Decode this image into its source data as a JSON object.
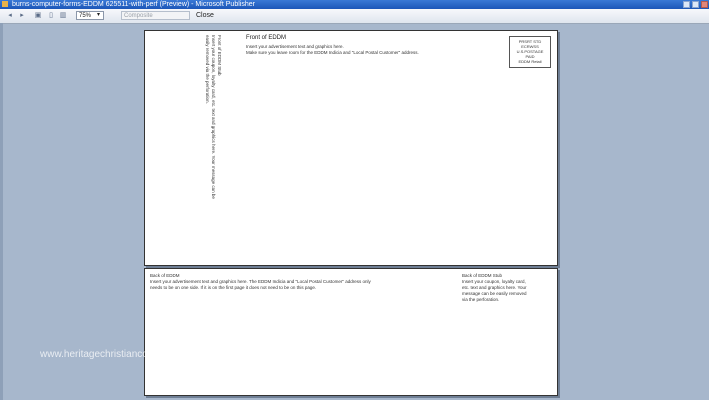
{
  "window": {
    "title": "burns-computer-forms-EDDM 625511-with-perf (Preview) - Microsoft Publisher"
  },
  "toolbar": {
    "zoom_value": "75%",
    "page_select": "Composite",
    "close_label": "Close"
  },
  "front": {
    "vertical_lines": [
      "Front of EDDM Stub",
      "Insert your coupon, loyalty card, etc. text and graphics here. Your message can be",
      "easily removed via the perforation."
    ],
    "title": "Front of EDDM",
    "line1": "Insert your advertisement text and graphics here.",
    "line2": "Make sure you leave room for the EDDM Indicia and \"Local Postal Customer\" address.",
    "postage": [
      "PRSRT STD",
      "ECRWSS",
      "U.S.POSTAGE",
      "PAID",
      "EDDM Retail"
    ]
  },
  "back": {
    "title": "Back of EDDM",
    "line1": "Insert your advertisement text and graphics here. The EDDM Indicia and \"Local Postal Customer\" address only",
    "line2": "needs to be on one side. If it is on the first page it does not need to be on this page.",
    "stub_title": "Back of EDDM Stub",
    "stub_lines": [
      "Insert your coupon, loyalty card,",
      "etc. text and graphics here. Your",
      "message can be easily removed",
      "via the perforation."
    ]
  },
  "watermark": "www.heritagechristiancollege.com"
}
